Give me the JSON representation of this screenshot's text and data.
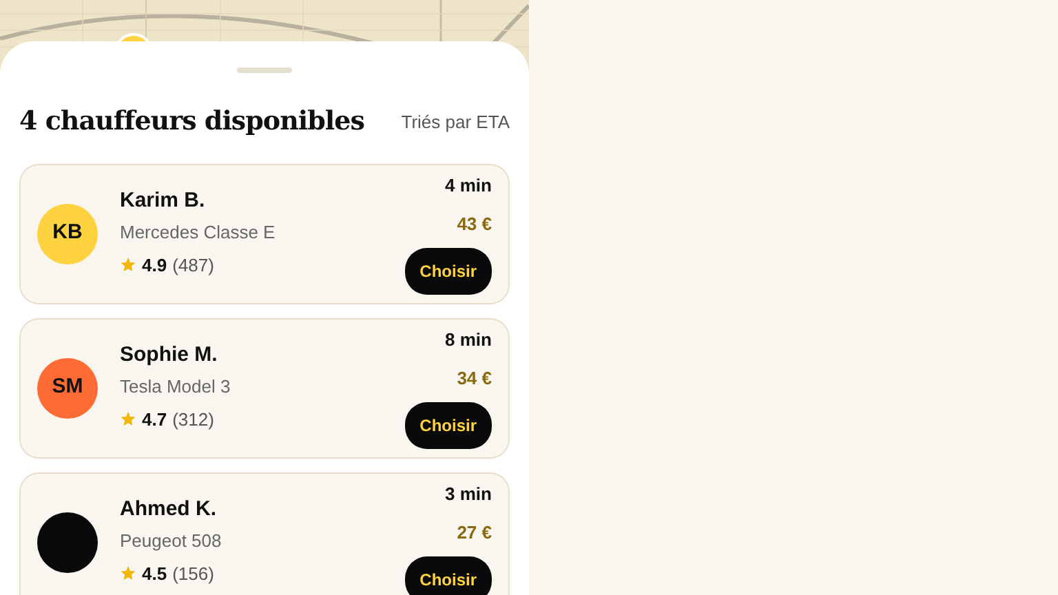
{
  "sheet": {
    "title": "4 chauffeurs disponibles",
    "sort_label": "Triés par ETA"
  },
  "drivers": [
    {
      "initials": "KB",
      "color": "#ffd23f",
      "name": "Karim B.",
      "car": "Mercedes Classe E",
      "rating": "4.9",
      "reviews": "(487)",
      "eta": "4 min",
      "price": "43 €",
      "button": "Choisir"
    },
    {
      "initials": "SM",
      "color": "#ff6b35",
      "name": "Sophie M.",
      "car": "Tesla Model 3",
      "rating": "4.7",
      "reviews": "(312)",
      "eta": "8 min",
      "price": "34 €",
      "button": "Choisir"
    },
    {
      "color": "#0a0a0a",
      "name": "Ahmed K.",
      "car": "Peugeot 508",
      "rating": "4.5",
      "reviews": "(156)",
      "eta": "3 min",
      "price": "27 €",
      "button": "Choisir"
    }
  ]
}
